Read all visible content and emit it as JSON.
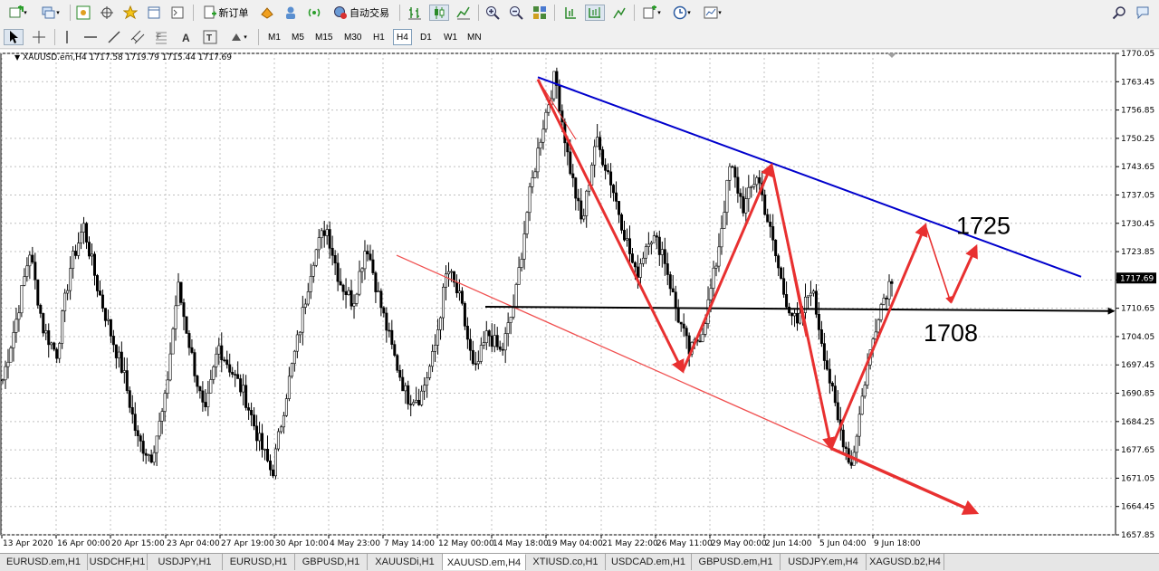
{
  "toolbar": {
    "new_order_label": "新订单",
    "auto_trading_label": "自动交易",
    "timeframes": [
      "M1",
      "M5",
      "M15",
      "M30",
      "H1",
      "H4",
      "D1",
      "W1",
      "MN"
    ],
    "active_timeframe": "H4"
  },
  "chart_header": {
    "text": "XAUUSD.em,H4  1717.58 1719.79 1715.44 1717.69"
  },
  "chart_data": {
    "type": "candlestick",
    "symbol": "XAUUSD.em",
    "timeframe": "H4",
    "ohlc_current": {
      "open": 1717.58,
      "high": 1719.79,
      "low": 1715.44,
      "close": 1717.69
    },
    "current_price_label": "1717.69",
    "y_ticks": [
      "1770.05",
      "1763.45",
      "1756.85",
      "1750.25",
      "1743.65",
      "1737.05",
      "1730.45",
      "1723.85",
      "1717.25",
      "1710.65",
      "1704.05",
      "1697.45",
      "1690.85",
      "1684.25",
      "1677.65",
      "1671.05",
      "1664.45",
      "1657.85"
    ],
    "ylim": [
      1657.85,
      1770.05
    ],
    "x_ticks": [
      "13 Apr 2020",
      "16 Apr 00:00",
      "20 Apr 15:00",
      "23 Apr 04:00",
      "27 Apr 19:00",
      "30 Apr 10:00",
      "4 May 23:00",
      "7 May 14:00",
      "12 May 00:00",
      "14 May 18:00",
      "19 May 04:00",
      "21 May 22:00",
      "26 May 11:00",
      "29 May 00:00",
      "2 Jun 14:00",
      "5 Jun 04:00",
      "9 Jun 18:00"
    ],
    "annotations": [
      {
        "text": "1725",
        "price": 1725
      },
      {
        "text": "1708",
        "price": 1708
      }
    ],
    "price_waypoints": [
      1694,
      1708,
      1724,
      1706,
      1700,
      1720,
      1730,
      1716,
      1705,
      1695,
      1680,
      1676,
      1688,
      1716,
      1700,
      1685,
      1702,
      1696,
      1690,
      1680,
      1672,
      1690,
      1705,
      1722,
      1730,
      1717,
      1712,
      1726,
      1712,
      1700,
      1690,
      1690,
      1700,
      1720,
      1712,
      1695,
      1705,
      1700,
      1712,
      1735,
      1752,
      1765,
      1745,
      1730,
      1750,
      1742,
      1730,
      1718,
      1728,
      1724,
      1710,
      1700,
      1706,
      1722,
      1744,
      1734,
      1742,
      1728,
      1714,
      1706,
      1716,
      1700,
      1684,
      1674,
      1694,
      1710,
      1718
    ],
    "seed": 7
  },
  "tabs": [
    "EURUSD.em,H1",
    "USDCHF,H1",
    "USDJPY,H1",
    "EURUSD,H1",
    "GBPUSD,H1",
    "XAUUSDi,H1",
    "XAUUSD.em,H4",
    "XTIUSD.co,H1",
    "USDCAD.em,H1",
    "GBPUSD.em,H1",
    "USDJPY.em,H4",
    "XAGUSD.b2,H4"
  ],
  "active_tab": "XAUUSD.em,H4",
  "colors": {
    "trend_blue": "#0000cc",
    "arrow_red": "#e83030",
    "support_red": "#f05050",
    "level_black": "#000000"
  },
  "icons": [
    "new-chart-icon",
    "profiles-icon",
    "chart-properties-icon",
    "crosshair-icon",
    "favorites-icon",
    "navigator-icon",
    "terminal-icon",
    "new-order-icon",
    "metaeditor-icon",
    "experts-icon",
    "signals-icon",
    "auto-trading-icon",
    "bar-chart-icon",
    "candlestick-icon",
    "line-chart-icon",
    "zoom-in-icon",
    "zoom-out-icon",
    "tile-windows-icon",
    "autoscroll-icon",
    "chart-shift-icon",
    "indicators-icon",
    "periods-icon",
    "templates-icon",
    "search-icon",
    "community-icon",
    "cursor-icon",
    "crosshair-tool-icon",
    "vertical-line-icon",
    "horizontal-line-icon",
    "trendline-icon",
    "equidistant-channel-icon",
    "fibonacci-icon",
    "text-icon",
    "text-label-icon",
    "arrows-icon"
  ]
}
